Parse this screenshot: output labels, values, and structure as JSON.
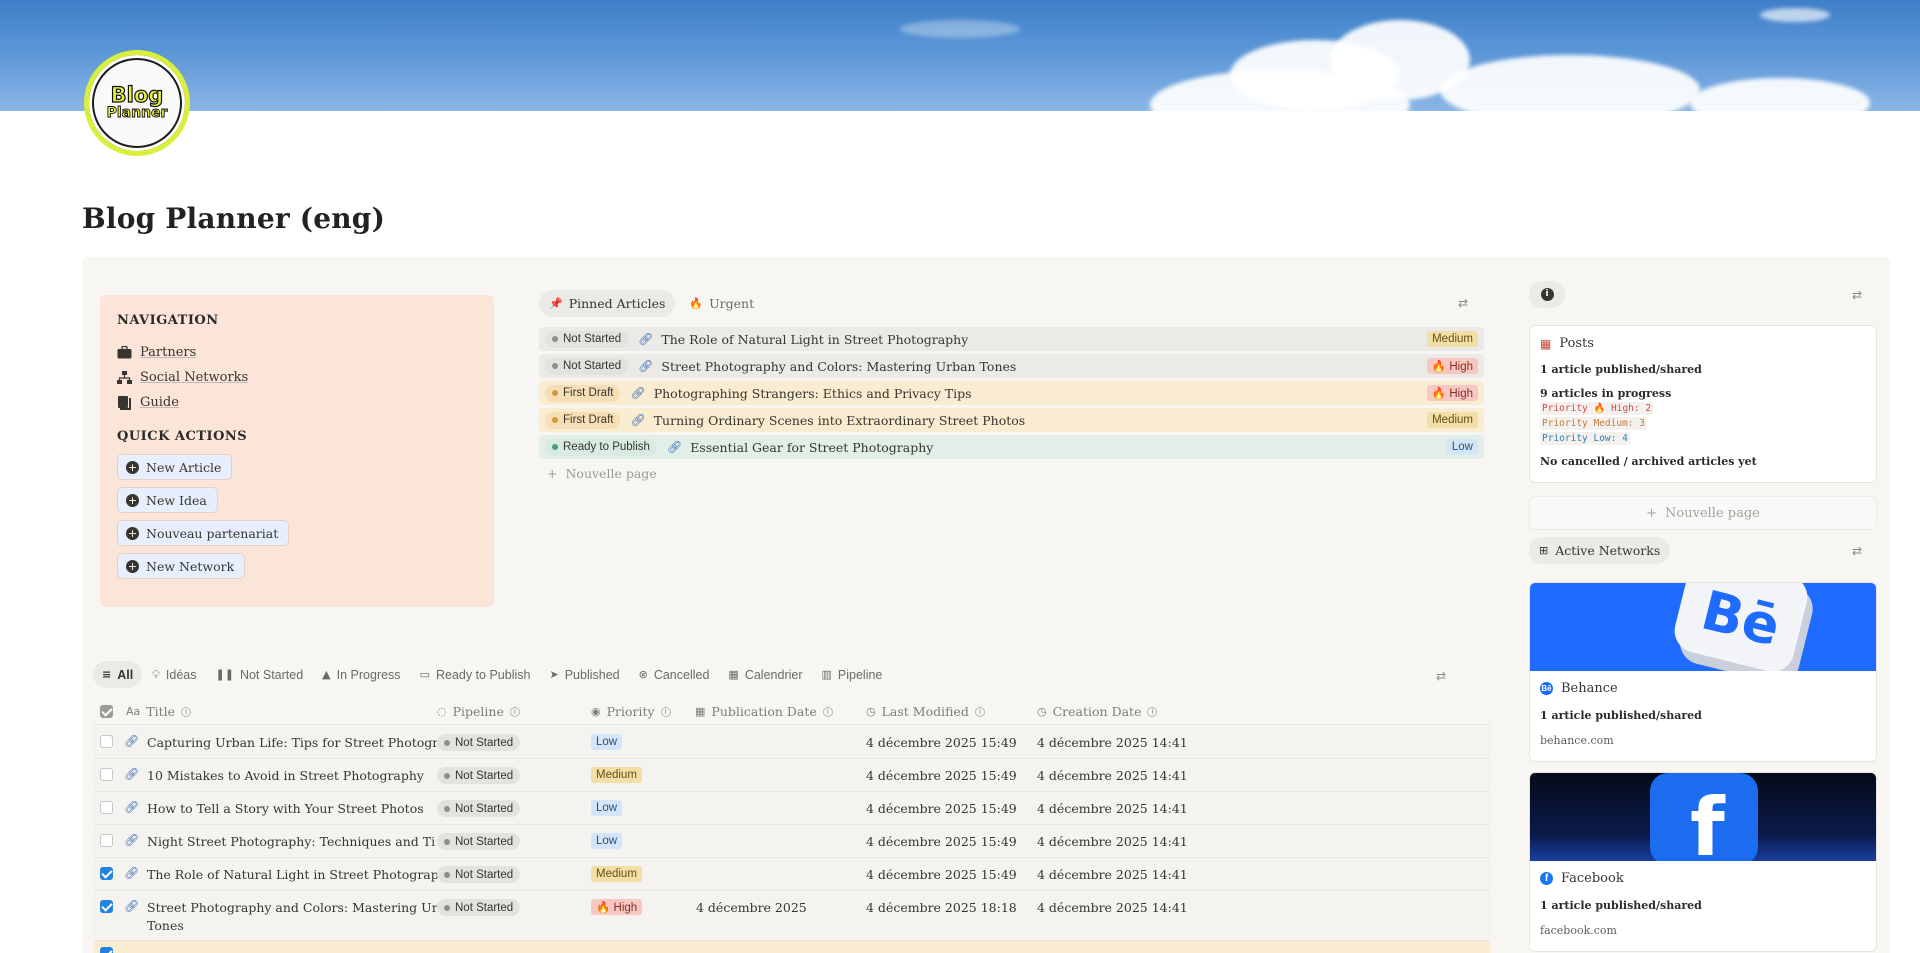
{
  "page": {
    "title": "Blog Planner (eng)"
  },
  "logo": {
    "line1": "Blog",
    "line2": "Planner"
  },
  "navigation": {
    "heading": "NAVIGATION",
    "links": [
      {
        "label": "Partners",
        "icon": "briefcase-icon"
      },
      {
        "label": "Social Networks",
        "icon": "network-icon"
      },
      {
        "label": "Guide",
        "icon": "book-icon"
      }
    ],
    "quick_actions_heading": "QUICK ACTIONS",
    "quick_actions": [
      {
        "label": "New Article"
      },
      {
        "label": "New Idea"
      },
      {
        "label": "Nouveau partenariat"
      },
      {
        "label": "New Network"
      }
    ]
  },
  "pinned": {
    "tabs": [
      {
        "label": "Pinned Articles"
      },
      {
        "label": "Urgent"
      }
    ],
    "rows": [
      {
        "status": "Not Started",
        "title": "The Role of Natural Light in Street Photography",
        "priority": "Medium"
      },
      {
        "status": "Not Started",
        "title": "Street Photography and Colors: Mastering Urban Tones",
        "priority": "🔥 High"
      },
      {
        "status": "First Draft",
        "title": "Photographing Strangers: Ethics and Privacy Tips",
        "priority": "🔥 High"
      },
      {
        "status": "First Draft",
        "title": "Turning Ordinary Scenes into Extraordinary Street Photos",
        "priority": "Medium"
      },
      {
        "status": "Ready to Publish",
        "title": "Essential Gear for Street Photography",
        "priority": "Low"
      }
    ],
    "new_page": "Nouvelle page"
  },
  "views": {
    "tabs": [
      "All",
      "Idéas",
      "Not Started",
      "In Progress",
      "Ready to Publish",
      "Published",
      "Cancelled",
      "Calendrier",
      "Pipeline"
    ]
  },
  "table": {
    "columns": {
      "title": "Title",
      "pipeline": "Pipeline",
      "priority": "Priority",
      "publication_date": "Publication Date",
      "last_modified": "Last Modified",
      "creation_date": "Creation Date"
    },
    "rows": [
      {
        "checked": false,
        "title": "Capturing Urban Life: Tips for Street Photography",
        "title2": "",
        "pipeline": "Not Started",
        "priority": "Low",
        "publication_date": "",
        "last_modified": "4 décembre 2025 15:49",
        "creation_date": "4 décembre 2025 14:41"
      },
      {
        "checked": false,
        "title": "10 Mistakes to Avoid in Street Photography",
        "title2": "",
        "pipeline": "Not Started",
        "priority": "Medium",
        "publication_date": "",
        "last_modified": "4 décembre 2025 15:49",
        "creation_date": "4 décembre 2025 14:41"
      },
      {
        "checked": false,
        "title": "How to Tell a Story with Your Street Photos",
        "title2": "",
        "pipeline": "Not Started",
        "priority": "Low",
        "publication_date": "",
        "last_modified": "4 décembre 2025 15:49",
        "creation_date": "4 décembre 2025 14:41"
      },
      {
        "checked": false,
        "title": "Night Street Photography: Techniques and Ti",
        "title2": "",
        "pipeline": "Not Started",
        "priority": "Low",
        "publication_date": "",
        "last_modified": "4 décembre 2025 15:49",
        "creation_date": "4 décembre 2025 14:41"
      },
      {
        "checked": true,
        "title": "The Role of Natural Light in Street Photography",
        "title2": "",
        "pipeline": "Not Started",
        "priority": "Medium",
        "publication_date": "",
        "last_modified": "4 décembre 2025 15:49",
        "creation_date": "4 décembre 2025 14:41"
      },
      {
        "checked": true,
        "title": "Street Photography and Colors: Mastering Urban",
        "title2": "Tones",
        "pipeline": "Not Started",
        "priority": "🔥 High",
        "publication_date": "4 décembre 2025",
        "last_modified": "4 décembre 2025 18:18",
        "creation_date": "4 décembre 2025 14:41"
      }
    ]
  },
  "sidebar": {
    "posts": {
      "title": "Posts",
      "published": "1 article published/shared",
      "in_progress": "9 articles in progress",
      "priority_high": "Priority 🔥 High: 2",
      "priority_medium": "Priority Medium: 3",
      "priority_low": "Priority Low: 4",
      "cancelled": "No cancelled / archived articles yet"
    },
    "new_page": "Nouvelle page",
    "networks_tab": "Active Networks",
    "networks": [
      {
        "name": "Behance",
        "stat": "1 article published/shared",
        "url": "behance.com",
        "color": "#1769ff"
      },
      {
        "name": "Facebook",
        "stat": "1 article published/shared",
        "url": "facebook.com",
        "color": "#1877f2"
      }
    ]
  },
  "colors": {
    "accent_blue": "#2383e2",
    "nav_card": "#fbe4d8",
    "logo_ring": "#d9ef3c"
  }
}
